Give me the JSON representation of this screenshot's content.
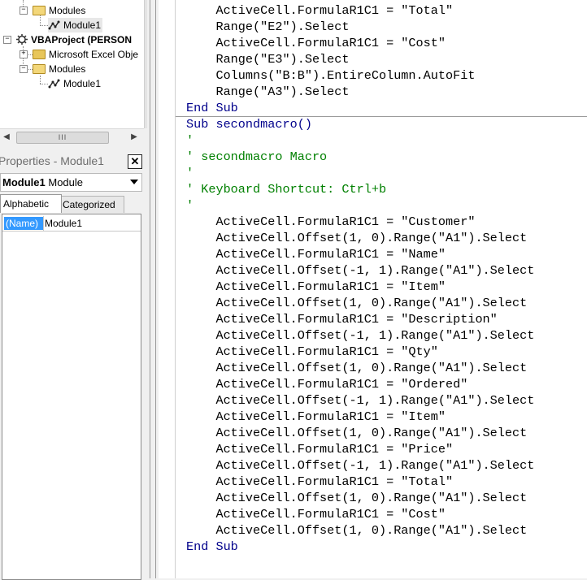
{
  "project_tree": {
    "items": [
      {
        "label": "Modules"
      },
      {
        "label": "Module1"
      },
      {
        "label": "VBAProject (PERSON"
      },
      {
        "label": "Microsoft Excel Obje"
      },
      {
        "label": "Modules"
      },
      {
        "label": "Module1"
      }
    ],
    "scrollbar_thumb_grip": "III"
  },
  "properties": {
    "title": "Properties - Module1",
    "close_glyph": "✕",
    "object_name": "Module1",
    "object_type": "Module",
    "tabs": [
      "Alphabetic",
      "Categorized"
    ],
    "rows": [
      {
        "name": "(Name)",
        "value": "Module1"
      }
    ]
  },
  "code": {
    "lines": [
      {
        "text": "    ActiveCell.FormulaR1C1 = \"Total\"",
        "kind": "normal"
      },
      {
        "text": "    Range(\"E2\").Select",
        "kind": "normal"
      },
      {
        "text": "    ActiveCell.FormulaR1C1 = \"Cost\"",
        "kind": "normal"
      },
      {
        "text": "    Range(\"E3\").Select",
        "kind": "normal"
      },
      {
        "text": "    Columns(\"B:B\").EntireColumn.AutoFit",
        "kind": "normal"
      },
      {
        "text": "    Range(\"A3\").Select",
        "kind": "normal"
      },
      {
        "text": "End Sub",
        "kind": "keyword"
      },
      {
        "text": "Sub secondmacro()",
        "kind": "keyword"
      },
      {
        "text": "'",
        "kind": "comment"
      },
      {
        "text": "' secondmacro Macro",
        "kind": "comment"
      },
      {
        "text": "'",
        "kind": "comment"
      },
      {
        "text": "' Keyboard Shortcut: Ctrl+b",
        "kind": "comment"
      },
      {
        "text": "'",
        "kind": "comment"
      },
      {
        "text": "    ActiveCell.FormulaR1C1 = \"Customer\"",
        "kind": "normal"
      },
      {
        "text": "    ActiveCell.Offset(1, 0).Range(\"A1\").Select",
        "kind": "normal"
      },
      {
        "text": "    ActiveCell.FormulaR1C1 = \"Name\"",
        "kind": "normal"
      },
      {
        "text": "    ActiveCell.Offset(-1, 1).Range(\"A1\").Select",
        "kind": "normal"
      },
      {
        "text": "    ActiveCell.FormulaR1C1 = \"Item\"",
        "kind": "normal"
      },
      {
        "text": "    ActiveCell.Offset(1, 0).Range(\"A1\").Select",
        "kind": "normal"
      },
      {
        "text": "    ActiveCell.FormulaR1C1 = \"Description\"",
        "kind": "normal"
      },
      {
        "text": "    ActiveCell.Offset(-1, 1).Range(\"A1\").Select",
        "kind": "normal"
      },
      {
        "text": "    ActiveCell.FormulaR1C1 = \"Qty\"",
        "kind": "normal"
      },
      {
        "text": "    ActiveCell.Offset(1, 0).Range(\"A1\").Select",
        "kind": "normal"
      },
      {
        "text": "    ActiveCell.FormulaR1C1 = \"Ordered\"",
        "kind": "normal"
      },
      {
        "text": "    ActiveCell.Offset(-1, 1).Range(\"A1\").Select",
        "kind": "normal"
      },
      {
        "text": "    ActiveCell.FormulaR1C1 = \"Item\"",
        "kind": "normal"
      },
      {
        "text": "    ActiveCell.Offset(1, 0).Range(\"A1\").Select",
        "kind": "normal"
      },
      {
        "text": "    ActiveCell.FormulaR1C1 = \"Price\"",
        "kind": "normal"
      },
      {
        "text": "    ActiveCell.Offset(-1, 1).Range(\"A1\").Select",
        "kind": "normal"
      },
      {
        "text": "    ActiveCell.FormulaR1C1 = \"Total\"",
        "kind": "normal"
      },
      {
        "text": "    ActiveCell.Offset(1, 0).Range(\"A1\").Select",
        "kind": "normal"
      },
      {
        "text": "    ActiveCell.FormulaR1C1 = \"Cost\"",
        "kind": "normal"
      },
      {
        "text": "    ActiveCell.Offset(1, 0).Range(\"A1\").Select",
        "kind": "normal"
      },
      {
        "text": "End Sub",
        "kind": "keyword"
      }
    ]
  },
  "colors": {
    "keyword": "#00008b",
    "comment": "#008000",
    "selection": "#3399ff"
  }
}
